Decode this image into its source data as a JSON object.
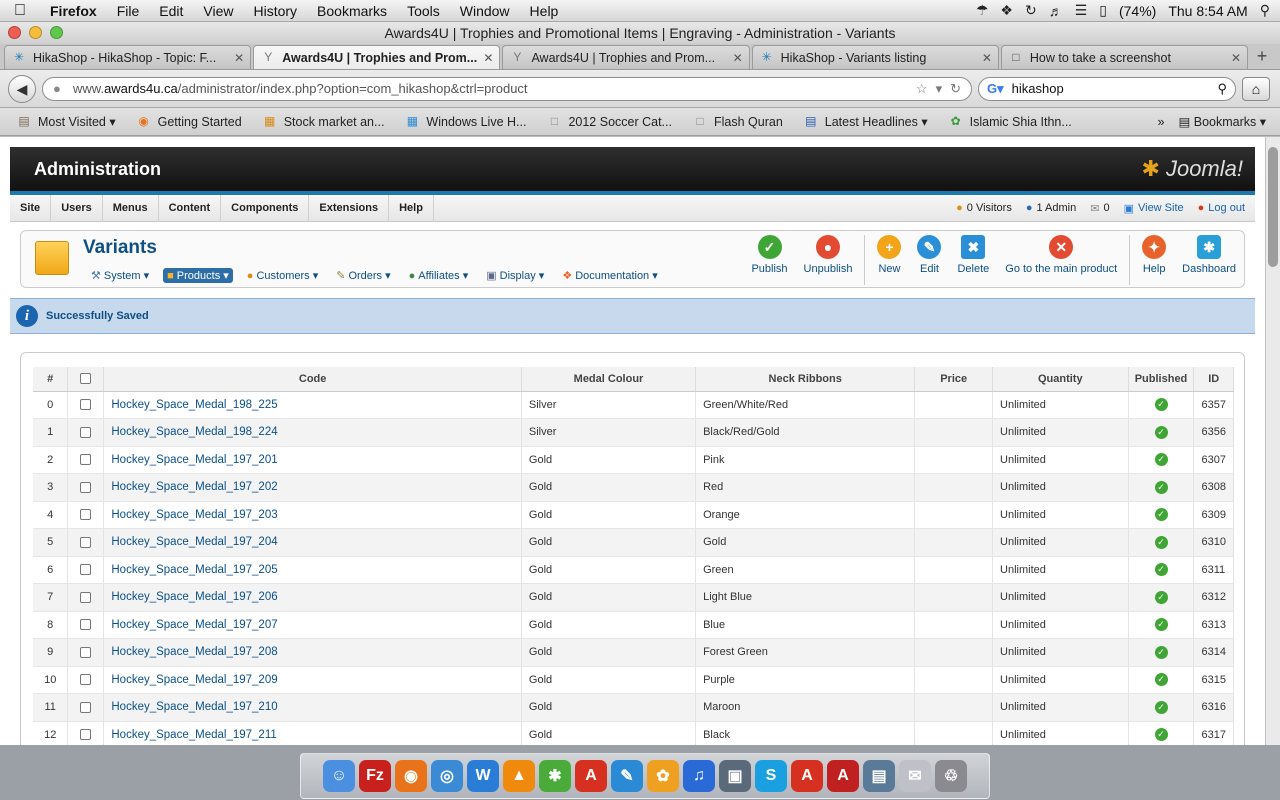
{
  "menubar": {
    "app": "Firefox",
    "items": [
      "File",
      "Edit",
      "View",
      "History",
      "Bookmarks",
      "Tools",
      "Window",
      "Help"
    ],
    "battery": "(74%)",
    "clock": "Thu 8:54 AM"
  },
  "window": {
    "title": "Awards4U | Trophies and Promotional Items | Engraving - Administration - Variants"
  },
  "tabs": [
    {
      "label": "HikaShop - HikaShop - Topic: F...",
      "icon": "hikashop-icon"
    },
    {
      "label": "Awards4U | Trophies and Prom...",
      "icon": "trophy-icon"
    },
    {
      "label": "Awards4U | Trophies and Prom...",
      "icon": "trophy-icon"
    },
    {
      "label": "HikaShop - Variants listing",
      "icon": "hikashop-icon"
    },
    {
      "label": "How to take a screenshot",
      "icon": "page-icon"
    }
  ],
  "nav": {
    "url_prefix": "www.",
    "url_domain": "awards4u.ca",
    "url_rest": "/administrator/index.php?option=com_hikashop&ctrl=product",
    "search_value": "hikashop"
  },
  "bookmarks": {
    "items": [
      {
        "label": "Most Visited ▾",
        "icon": "folder-icon"
      },
      {
        "label": "Getting Started",
        "icon": "firefox-icon"
      },
      {
        "label": "Stock market an...",
        "icon": "chart-icon"
      },
      {
        "label": "Windows Live H...",
        "icon": "windows-icon"
      },
      {
        "label": "2012 Soccer Cat...",
        "icon": "page-icon"
      },
      {
        "label": "Flash Quran",
        "icon": "page-icon"
      },
      {
        "label": "Latest Headlines ▾",
        "icon": "rss-icon"
      },
      {
        "label": "Islamic Shia Ithn...",
        "icon": "leaf-icon"
      }
    ],
    "more": "»",
    "bookmarks_menu": "Bookmarks ▾"
  },
  "admin": {
    "title": "Administration",
    "logo": "Joomla!",
    "menu": [
      "Site",
      "Users",
      "Menus",
      "Content",
      "Components",
      "Extensions",
      "Help"
    ],
    "status": {
      "visitors": "0 Visitors",
      "admins": "1 Admin",
      "messages": "0",
      "view_site": "View Site",
      "logout": "Log out"
    }
  },
  "page": {
    "title": "Variants",
    "submenu": [
      {
        "label": "System ▾",
        "icon": "wrench-icon"
      },
      {
        "label": "Products ▾",
        "icon": "box-icon",
        "active": true
      },
      {
        "label": "Customers ▾",
        "icon": "users-icon"
      },
      {
        "label": "Orders ▾",
        "icon": "orders-icon"
      },
      {
        "label": "Affiliates ▾",
        "icon": "affiliates-icon"
      },
      {
        "label": "Display ▾",
        "icon": "display-icon"
      },
      {
        "label": "Documentation ▾",
        "icon": "lifebuoy-icon"
      }
    ],
    "toolbar": [
      {
        "label": "Publish",
        "icon": "publish-icon",
        "color": "#3fa534",
        "glyph": "✓"
      },
      {
        "label": "Unpublish",
        "icon": "unpublish-icon",
        "color": "#e34a32",
        "glyph": "●"
      },
      {
        "label": "New",
        "icon": "new-icon",
        "color": "#f3a419",
        "glyph": "+"
      },
      {
        "label": "Edit",
        "icon": "edit-icon",
        "color": "#2a8fd6",
        "glyph": "✎"
      },
      {
        "label": "Delete",
        "icon": "delete-icon",
        "color": "#2a8fd6",
        "glyph": "✖"
      },
      {
        "label": "Go to the main product",
        "icon": "cancel-icon",
        "color": "#e34a32",
        "glyph": "✕"
      },
      {
        "label": "Help",
        "icon": "help-icon",
        "color": "#e8632b",
        "glyph": "✦"
      },
      {
        "label": "Dashboard",
        "icon": "dashboard-icon",
        "color": "#2a9ed6",
        "glyph": "✱"
      }
    ],
    "message": "Successfully Saved"
  },
  "table": {
    "columns": [
      "#",
      "",
      "Code",
      "Medal Colour",
      "Neck Ribbons",
      "Price",
      "Quantity",
      "Published",
      "ID"
    ],
    "rows": [
      {
        "num": "0",
        "code": "Hockey_Space_Medal_198_225",
        "colour": "Silver",
        "ribbon": "Green/White/Red",
        "price": "",
        "qty": "Unlimited",
        "id": "6357"
      },
      {
        "num": "1",
        "code": "Hockey_Space_Medal_198_224",
        "colour": "Silver",
        "ribbon": "Black/Red/Gold",
        "price": "",
        "qty": "Unlimited",
        "id": "6356"
      },
      {
        "num": "2",
        "code": "Hockey_Space_Medal_197_201",
        "colour": "Gold",
        "ribbon": "Pink",
        "price": "",
        "qty": "Unlimited",
        "id": "6307"
      },
      {
        "num": "3",
        "code": "Hockey_Space_Medal_197_202",
        "colour": "Gold",
        "ribbon": "Red",
        "price": "",
        "qty": "Unlimited",
        "id": "6308"
      },
      {
        "num": "4",
        "code": "Hockey_Space_Medal_197_203",
        "colour": "Gold",
        "ribbon": "Orange",
        "price": "",
        "qty": "Unlimited",
        "id": "6309"
      },
      {
        "num": "5",
        "code": "Hockey_Space_Medal_197_204",
        "colour": "Gold",
        "ribbon": "Gold",
        "price": "",
        "qty": "Unlimited",
        "id": "6310"
      },
      {
        "num": "6",
        "code": "Hockey_Space_Medal_197_205",
        "colour": "Gold",
        "ribbon": "Green",
        "price": "",
        "qty": "Unlimited",
        "id": "6311"
      },
      {
        "num": "7",
        "code": "Hockey_Space_Medal_197_206",
        "colour": "Gold",
        "ribbon": "Light Blue",
        "price": "",
        "qty": "Unlimited",
        "id": "6312"
      },
      {
        "num": "8",
        "code": "Hockey_Space_Medal_197_207",
        "colour": "Gold",
        "ribbon": "Blue",
        "price": "",
        "qty": "Unlimited",
        "id": "6313"
      },
      {
        "num": "9",
        "code": "Hockey_Space_Medal_197_208",
        "colour": "Gold",
        "ribbon": "Forest Green",
        "price": "",
        "qty": "Unlimited",
        "id": "6314"
      },
      {
        "num": "10",
        "code": "Hockey_Space_Medal_197_209",
        "colour": "Gold",
        "ribbon": "Purple",
        "price": "",
        "qty": "Unlimited",
        "id": "6315"
      },
      {
        "num": "11",
        "code": "Hockey_Space_Medal_197_210",
        "colour": "Gold",
        "ribbon": "Maroon",
        "price": "",
        "qty": "Unlimited",
        "id": "6316"
      },
      {
        "num": "12",
        "code": "Hockey_Space_Medal_197_211",
        "colour": "Gold",
        "ribbon": "Black",
        "price": "",
        "qty": "Unlimited",
        "id": "6317"
      }
    ]
  },
  "dock": {
    "items": [
      {
        "icon": "finder-icon",
        "color": "#4a8fe0",
        "glyph": "☺"
      },
      {
        "icon": "filezilla-icon",
        "color": "#c8201d",
        "glyph": "Fz"
      },
      {
        "icon": "firefox-icon",
        "color": "#e8731a",
        "glyph": "◉"
      },
      {
        "icon": "safari-icon",
        "color": "#3a8ad6",
        "glyph": "◎"
      },
      {
        "icon": "word-icon",
        "color": "#2a7dd6",
        "glyph": "W"
      },
      {
        "icon": "vlc-icon",
        "color": "#f08a0c",
        "glyph": "▲"
      },
      {
        "icon": "network-icon",
        "color": "#4aaa3a",
        "glyph": "✱"
      },
      {
        "icon": "acrobat-icon",
        "color": "#d63020",
        "glyph": "A"
      },
      {
        "icon": "quill-icon",
        "color": "#2a8ad6",
        "glyph": "✎"
      },
      {
        "icon": "flower-icon",
        "color": "#f0a020",
        "glyph": "✿"
      },
      {
        "icon": "itunes-icon",
        "color": "#2a6ad6",
        "glyph": "♫"
      },
      {
        "icon": "photo-icon",
        "color": "#5a6a7a",
        "glyph": "▣"
      },
      {
        "icon": "skype-icon",
        "color": "#1aa0e0",
        "glyph": "S"
      },
      {
        "icon": "acrobat-icon",
        "color": "#d63020",
        "glyph": "A"
      },
      {
        "icon": "acrobat-icon",
        "color": "#c02020",
        "glyph": "A"
      },
      {
        "icon": "preview-icon",
        "color": "#5a7a9a",
        "glyph": "▤"
      },
      {
        "icon": "mail-icon",
        "color": "#c0c0c8",
        "glyph": "✉"
      },
      {
        "icon": "trash-icon",
        "color": "#8a8a90",
        "glyph": "♲"
      }
    ]
  }
}
